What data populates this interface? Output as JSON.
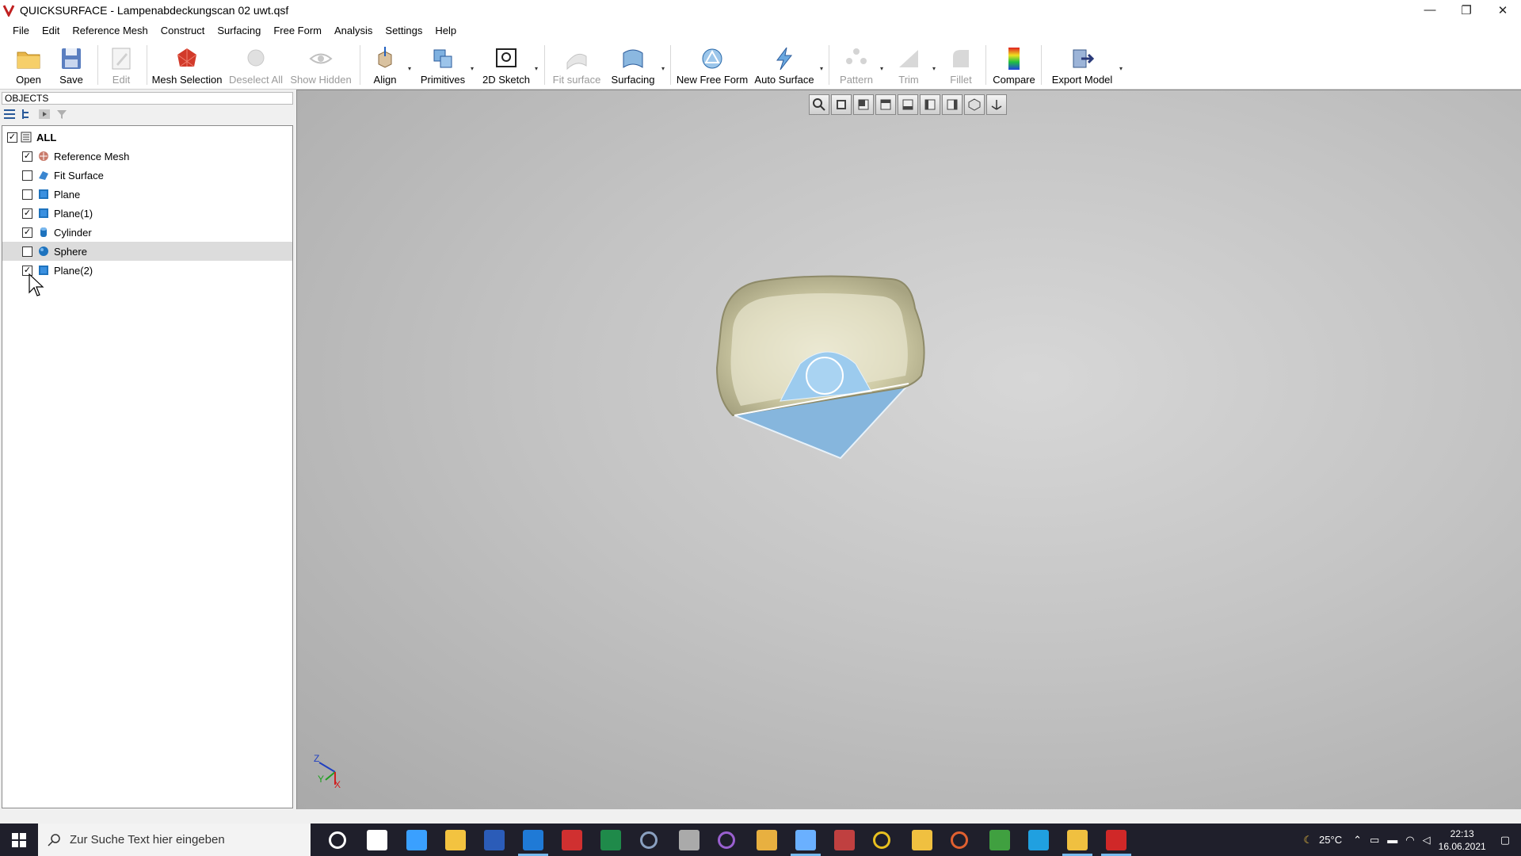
{
  "window": {
    "title": "QUICKSURFACE - Lampenabdeckungscan 02 uwt.qsf",
    "minimize": "—",
    "restore": "❐",
    "close": "✕"
  },
  "menu": [
    "File",
    "Edit",
    "Reference Mesh",
    "Construct",
    "Surfacing",
    "Free Form",
    "Analysis",
    "Settings",
    "Help"
  ],
  "toolbar": {
    "open": "Open",
    "save": "Save",
    "edit": "Edit",
    "mesh_selection": "Mesh Selection",
    "deselect_all": "Deselect All",
    "show_hidden": "Show Hidden",
    "align": "Align",
    "primitives": "Primitives",
    "sketch_2d": "2D Sketch",
    "fit_surface": "Fit surface",
    "surfacing": "Surfacing",
    "new_free_form": "New Free Form",
    "auto_surface": "Auto Surface",
    "pattern": "Pattern",
    "trim": "Trim",
    "fillet": "Fillet",
    "compare": "Compare",
    "export_model": "Export Model",
    "dropdown_glyph": "▾"
  },
  "objects": {
    "header": "OBJECTS",
    "all_label": "ALL",
    "check_glyph": "✓",
    "items": [
      {
        "label": "Reference Mesh",
        "checked": true,
        "icon": "mesh-icon"
      },
      {
        "label": "Fit Surface",
        "checked": false,
        "icon": "fit-surface-icon"
      },
      {
        "label": "Plane",
        "checked": false,
        "icon": "plane-icon"
      },
      {
        "label": "Plane(1)",
        "checked": true,
        "icon": "plane-icon"
      },
      {
        "label": "Cylinder",
        "checked": true,
        "icon": "cylinder-icon"
      },
      {
        "label": "Sphere",
        "checked": false,
        "icon": "sphere-icon",
        "selected": true
      },
      {
        "label": "Plane(2)",
        "checked": true,
        "icon": "plane-icon"
      }
    ]
  },
  "axes": {
    "z": "Z",
    "y": "Y",
    "x": "X"
  },
  "taskbar": {
    "search_placeholder": "Zur Suche Text hier eingeben",
    "temperature": "25°C",
    "time": "22:13",
    "date": "16.06.2021"
  },
  "colors": {
    "accent": "#1e73be",
    "plane_blue": "#86b6dd",
    "mesh": "#c9c5a4",
    "taskbar": "#1f1f2b"
  }
}
